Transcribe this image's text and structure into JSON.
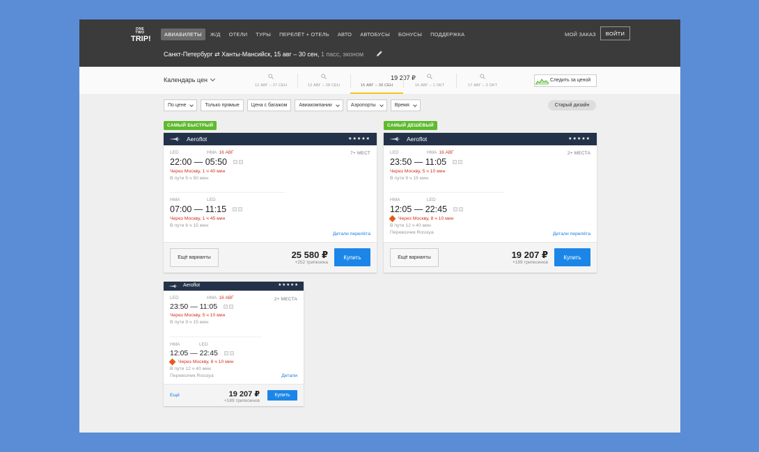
{
  "logo": {
    "line1": "ONE TWO",
    "line2": "TRIP!"
  },
  "nav": [
    {
      "label": "АВИАБИЛЕТЫ",
      "active": true
    },
    {
      "label": "Ж/Д"
    },
    {
      "label": "ОТЕЛИ"
    },
    {
      "label": "ТУРЫ"
    },
    {
      "label": "ПЕРЕЛЁТ + ОТЕЛЬ"
    },
    {
      "label": "АВТО"
    },
    {
      "label": "АВТОБУСЫ"
    },
    {
      "label": "БОНУСЫ"
    },
    {
      "label": "ПОДДЕРЖКА"
    }
  ],
  "header": {
    "my_order": "МОЙ ЗАКАЗ",
    "login": "ВОЙТИ"
  },
  "search": {
    "route": "Санкт-Петербург ⇄ Ханты-Мансийск, 15 авг – 30 сен,",
    "pax": " 1 пасс, эконом"
  },
  "calendar": {
    "label": "Календарь цен",
    "cells": [
      {
        "dates": "12 АВГ – 27 СЕН"
      },
      {
        "dates": "13 АВГ – 28 СЕН"
      },
      {
        "dates": "15 АВГ – 30 СЕН",
        "price": "19 207 ₽",
        "selected": true
      },
      {
        "dates": "16 АВГ – 1 ОКТ"
      },
      {
        "dates": "17 АВГ – 2 ОКТ"
      }
    ],
    "track_label": "Следить за ценой"
  },
  "filters": [
    {
      "label": "По цене",
      "dropdown": true
    },
    {
      "label": "Только прямые"
    },
    {
      "label": "Цена с багажом"
    },
    {
      "label": "Авиакомпании",
      "dropdown": true
    },
    {
      "label": "Аэропорты",
      "dropdown": true
    },
    {
      "label": "Время",
      "dropdown": true
    }
  ],
  "old_design": "Старый дизайн",
  "tags": {
    "fastest": "САМЫЙ  БЫСТРЫЙ",
    "cheapest": "САМЫЙ  ДЕШЁВЫЙ"
  },
  "cards": [
    {
      "airline": "Aeroflot",
      "stars": "★★★★★",
      "seats": "7+ МЕСТ",
      "out": {
        "from": "LED",
        "to": "HMA",
        "date": "16 АВГ",
        "time": "22:00 — 05:50",
        "via": "Через Москву, 1 ч 40 мин",
        "dur": "В пути 5 ч 50 мин"
      },
      "back": {
        "from": "HMA",
        "to": "LED",
        "time": "07:00 — 11:15",
        "via": "Через Москву, 1 ч 45 мин",
        "dur": "В пути 6 ч 15 мин"
      },
      "details": "Детали перелёта",
      "more": "Ещё варианты",
      "price": "25 580 ₽",
      "coins": "+252 трипкоина",
      "buy": "Купить"
    },
    {
      "airline": "Aeroflot",
      "stars": "★★★★★",
      "seats": "2+ МЕСТА",
      "out": {
        "from": "LED",
        "to": "HMA",
        "date": "16 АВГ",
        "time": "23:50 — 11:05",
        "via": "Через Москву, 5 ч 10 мин",
        "dur": "В пути 9 ч 15 мин"
      },
      "back": {
        "from": "HMA",
        "to": "LED",
        "time": "12:05 — 22:45",
        "via": "Через Москву, 8 ч 10 мин",
        "dur": "В пути 12 ч 40 мин",
        "carrier": "Перевозчик Rossiya"
      },
      "details": "Детали перелёта",
      "more": "Ещё варианты",
      "price": "19 207 ₽",
      "coins": "+189 трипкоинов",
      "buy": "Купить"
    },
    {
      "airline": "Aeroflot",
      "stars": "★★★★★",
      "seats": "2+ МЕСТА",
      "out": {
        "from": "LED",
        "to": "HMA",
        "date": "16 АВГ",
        "time": "23:50 — 11:05",
        "via": "Через Москву, 5 ч 10 мин",
        "dur": "В пути 9 ч 15 мин"
      },
      "back": {
        "from": "HMA",
        "to": "LED",
        "time": "12:05 — 22:45",
        "via": "Через Москву, 8 ч 10 мин",
        "dur": "В пути 12 ч 40 мин",
        "carrier": "Перевозчик Rossiya"
      },
      "details": "Детали",
      "more": "Ещё",
      "price": "19 207 ₽",
      "coins": "+189 трипкоинов",
      "buy": "Купить"
    }
  ]
}
